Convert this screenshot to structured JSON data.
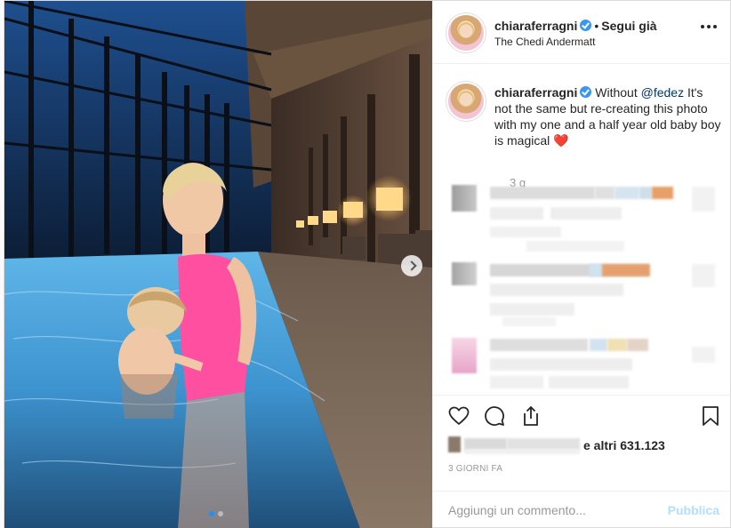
{
  "post": {
    "author": {
      "username": "chiaraferragni",
      "verified": true,
      "follow_status": "Segui già",
      "location": "The Chedi Andermatt"
    },
    "caption": {
      "text_before_mention": "Without ",
      "mention": "@fedez",
      "text_after_mention": " It's not the same but re-creating this photo with my one and a half year old baby boy is magical ",
      "emoji": "❤️",
      "time": "3 g"
    },
    "likes": {
      "suffix": "e altri 631.123"
    },
    "date": "3 GIORNI FA",
    "comment_input": {
      "placeholder": "Aggiungi un commento..."
    },
    "publish_label": "Pubblica"
  },
  "icons": [
    "verified-icon",
    "more-options-icon",
    "heart-icon",
    "comment-icon",
    "share-icon",
    "bookmark-icon",
    "next-arrow-icon"
  ],
  "colors": {
    "link": "#003569",
    "verified": "#3897f0",
    "publish_disabled": "#b2dffc",
    "muted": "#999999",
    "swimsuit": "#ff4fa0"
  }
}
